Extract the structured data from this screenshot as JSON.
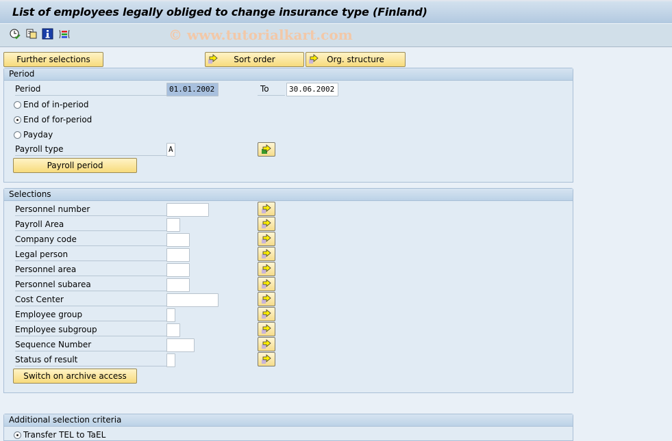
{
  "window": {
    "title": "List of employees legally obliged to change insurance type (Finland)",
    "watermark": "© www.tutorialkart.com"
  },
  "toolbar": {
    "icons": [
      "execute-clock-icon",
      "get-variant-icon",
      "info-icon",
      "selection-options-icon"
    ]
  },
  "buttons": {
    "further_selections": "Further selections",
    "sort_order": "Sort order",
    "org_structure": "Org. structure"
  },
  "period_group": {
    "title": "Period",
    "period_label": "Period",
    "period_from": "01.01.2002",
    "to_label": "To",
    "period_to": "30.06.2002",
    "radios": [
      {
        "label": "End of in-period",
        "selected": false
      },
      {
        "label": "End of for-period",
        "selected": true
      },
      {
        "label": "Payday",
        "selected": false
      }
    ],
    "payroll_type_label": "Payroll type",
    "payroll_type_value": "A",
    "payroll_period_button": "Payroll period"
  },
  "selections_group": {
    "title": "Selections",
    "rows": [
      {
        "label": "Personnel number",
        "value": ""
      },
      {
        "label": "Payroll Area",
        "value": ""
      },
      {
        "label": "Company code",
        "value": ""
      },
      {
        "label": "Legal person",
        "value": ""
      },
      {
        "label": "Personnel area",
        "value": ""
      },
      {
        "label": "Personnel subarea",
        "value": ""
      },
      {
        "label": "Cost Center",
        "value": ""
      },
      {
        "label": "Employee group",
        "value": ""
      },
      {
        "label": "Employee subgroup",
        "value": ""
      },
      {
        "label": "Sequence Number",
        "value": ""
      },
      {
        "label": "Status of result",
        "value": ""
      }
    ],
    "archive_button": "Switch on archive access"
  },
  "additional_group": {
    "title": "Additional selection criteria",
    "radio_label": "Transfer TEL to TaEL",
    "radio_selected": true
  }
}
